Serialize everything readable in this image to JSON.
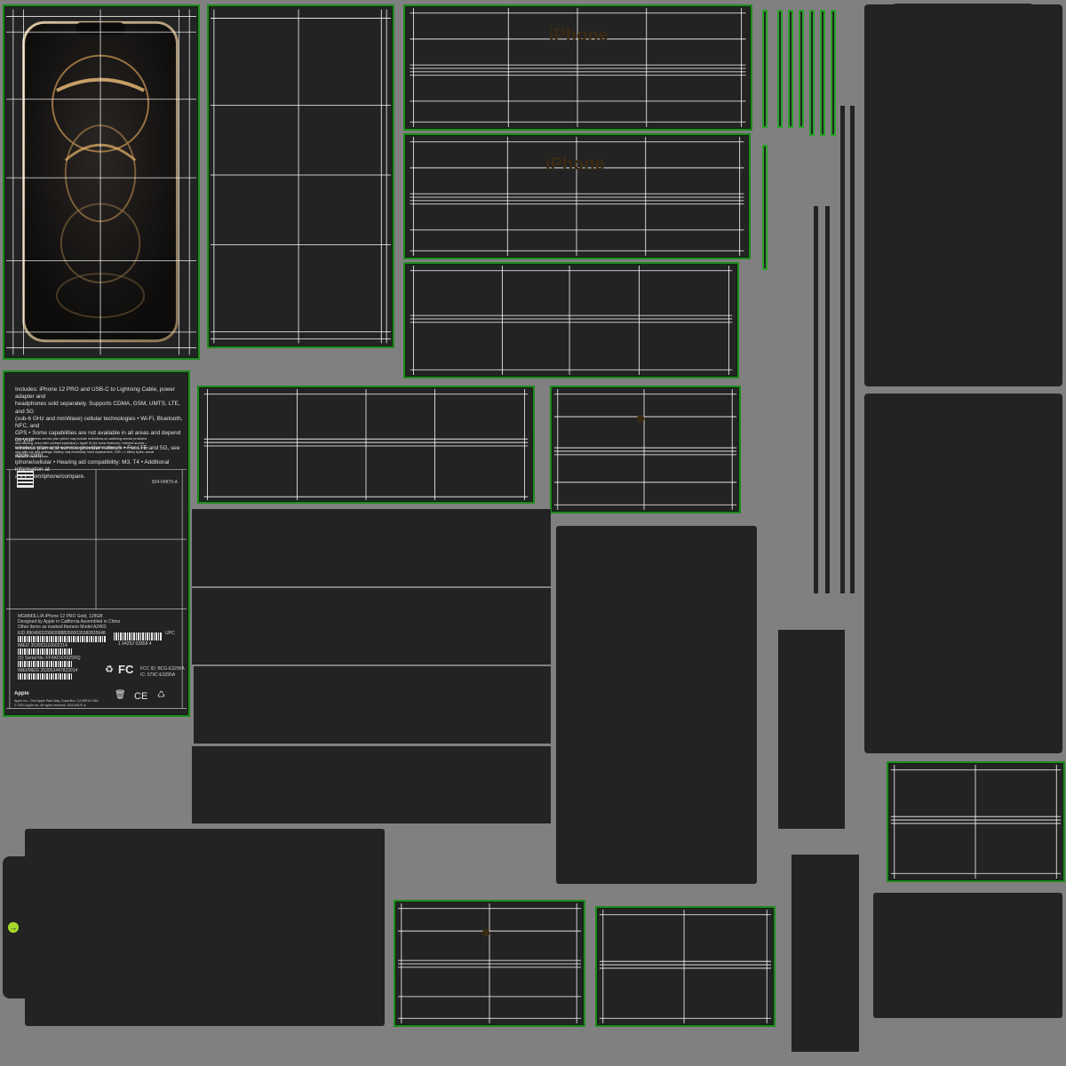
{
  "texture": {
    "background_color": "#808080",
    "panel_color": "#232323",
    "seam_color": "#2aa32a",
    "grid_color": "#ffffff",
    "accent_icon": "arrow-right-circle-icon"
  },
  "box_back": {
    "description_lines": [
      "Includes: iPhone 12 PRO and USB-C to Lightning Cable, power adapter and",
      "headphones sold separately. Supports CDMA, GSM, UMTS, LTE, and 5G",
      "(sub-6 GHz and mmWave) cellular technologies • Wi-Fi, Bluetooth, NFC, and",
      "GPS • Some capabilities are not available in all areas and depend on your",
      "wireless plan and service provider network • For LTE and 5G, see apple.com/",
      "iphone/cellular • Hearing aid compatibility: M3, T4 • Additional information at",
      "apple.com/iphone/compare."
    ],
    "fine_print_lines": [
      "Requires Wireless service plan (which may include restrictions on switching service providers",
      "and roaming, even after contract expiration) • Apple ID (for some features) • Internet access •",
      "Acceptance of the software license terms at apple.com/legal/sla. Battery life and charge cycles",
      "vary with use and settings. Battery may eventually need replacement. 1GB = 1 billion bytes; actual",
      "formatted capacity less."
    ],
    "part_number": "824-04870-A",
    "model_line": "MGMM3LL/A iPhone 12 PRO Gold, 128GB",
    "designed_line": "Designed by Apple in California Assembled in China",
    "other_items_line": "Other items as marked thereon Model A2403",
    "eid_line": "EID 89049032006008882600035380835648",
    "upc_label": "UPC",
    "upc_digits": "1 94252 02858 4",
    "imei_line": "IMEI2 353053110602214",
    "serial_line": "(S) Serial No. FFXKDXX0Z5RQ",
    "imei_meid_line": "IMEI/MEID 353053447823014",
    "fcc_id": "FCC ID: BCG-E3295A",
    "ic_line": "IC: 579C-E3295A",
    "fc_mark": "FC",
    "ce_mark": "CE",
    "brand": "Apple",
    "address_line": "Apple Inc., One Apple Park Way, Cupertino, CA 95014 USA",
    "copyright_line": "© 2020 Apple Inc. All rights reserved. 824-04870-A"
  },
  "ghost_labels": {
    "top_lid_1": "iPhone",
    "top_lid_2": "iPhone"
  }
}
